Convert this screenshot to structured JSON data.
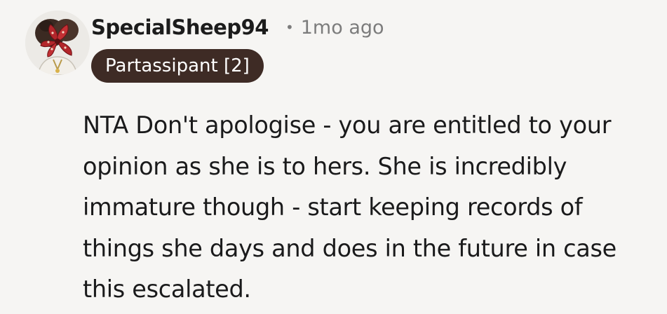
{
  "comment": {
    "author": "SpecialSheep94",
    "separator": "•",
    "timestamp": "1mo ago",
    "flair": "Partassipant [2]",
    "avatar_icon": "demogorgon-avatar-icon",
    "body": "NTA Don't apologise - you are entitled to your opinion as she is to hers. She is incredibly immature though - start keeping records of things she days and does in the future in case this escalated."
  },
  "colors": {
    "background": "#f6f5f3",
    "flair_background": "#3e2b25",
    "flair_text": "#ffffff",
    "meta_text": "#7c7c7c",
    "body_text": "#1a1a1b"
  }
}
